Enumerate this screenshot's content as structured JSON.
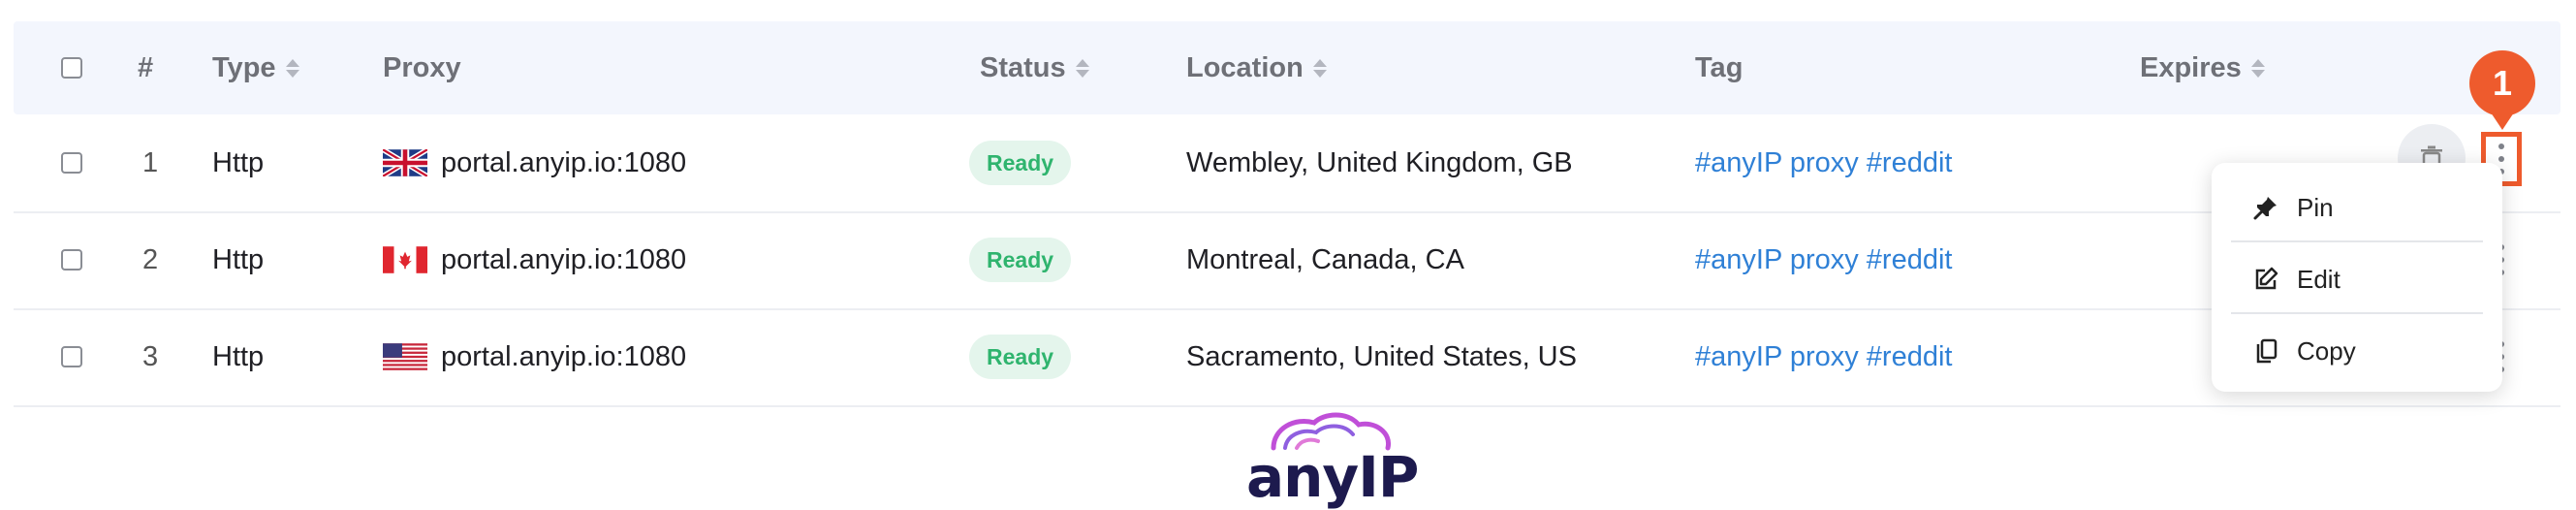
{
  "header": {
    "num": "#",
    "type": "Type",
    "proxy": "Proxy",
    "status": "Status",
    "location": "Location",
    "tag": "Tag",
    "expires": "Expires"
  },
  "rows": [
    {
      "num": "1",
      "type": "Http",
      "flag": "gb-flag-icon",
      "proxy": "portal.anyip.io:1080",
      "status": "Ready",
      "location": "Wembley, United Kingdom, GB",
      "tag": "#anyIP proxy #reddit"
    },
    {
      "num": "2",
      "type": "Http",
      "flag": "ca-flag-icon",
      "proxy": "portal.anyip.io:1080",
      "status": "Ready",
      "location": "Montreal, Canada, CA",
      "tag": "#anyIP proxy #reddit"
    },
    {
      "num": "3",
      "type": "Http",
      "flag": "us-flag-icon",
      "proxy": "portal.anyip.io:1080",
      "status": "Ready",
      "location": "Sacramento, United States, US",
      "tag": "#anyIP proxy #reddit"
    }
  ],
  "context_menu": {
    "items": [
      {
        "label": "Pin",
        "icon": "pin-icon"
      },
      {
        "label": "Edit",
        "icon": "edit-icon"
      },
      {
        "label": "Copy",
        "icon": "copy-icon"
      }
    ]
  },
  "annotation": {
    "step": "1"
  },
  "logo": {
    "text": "anyIP"
  },
  "colors": {
    "header_bg": "#f3f6fd",
    "badge_bg": "#e4f5ec",
    "badge_text": "#2fb46e",
    "tag_link": "#2f80d6",
    "annotation": "#ee5b2d",
    "logo_dark": "#1d1a4e",
    "logo_accent": "#c04fd8"
  }
}
